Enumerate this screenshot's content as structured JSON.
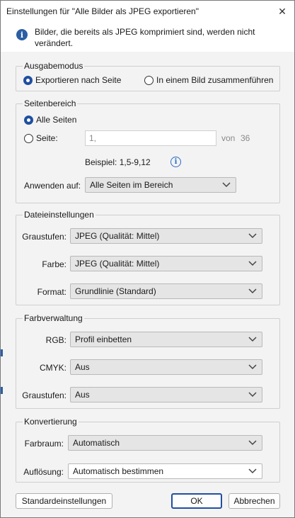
{
  "window": {
    "title": "Einstellungen für \"Alle Bilder als JPEG exportieren\""
  },
  "info": {
    "text": "Bilder, die bereits als JPEG komprimiert sind, werden nicht verändert."
  },
  "output_mode": {
    "legend": "Ausgabemodus",
    "option_per_page": "Exportieren nach Seite",
    "option_merge": "In einem Bild zusammenführen",
    "selected": "per_page"
  },
  "page_range": {
    "legend": "Seitenbereich",
    "option_all": "Alle Seiten",
    "option_page": "Seite:",
    "page_input_value": "1,",
    "of_label": "von",
    "total_pages": "36",
    "example": "Beispiel: 1,5-9,12",
    "apply_label": "Anwenden auf:",
    "apply_value": "Alle Seiten im Bereich",
    "selected": "all"
  },
  "file_settings": {
    "legend": "Dateieinstellungen",
    "grayscale_label": "Graustufen:",
    "grayscale_value": "JPEG (Qualität: Mittel)",
    "color_label": "Farbe:",
    "color_value": "JPEG (Qualität: Mittel)",
    "format_label": "Format:",
    "format_value": "Grundlinie (Standard)"
  },
  "color_management": {
    "legend": "Farbverwaltung",
    "rgb_label": "RGB:",
    "rgb_value": "Profil einbetten",
    "cmyk_label": "CMYK:",
    "cmyk_value": "Aus",
    "grayscale_label": "Graustufen:",
    "grayscale_value": "Aus"
  },
  "conversion": {
    "legend": "Konvertierung",
    "colorspace_label": "Farbraum:",
    "colorspace_value": "Automatisch",
    "resolution_label": "Auflösung:",
    "resolution_value": "Automatisch bestimmen"
  },
  "footer": {
    "defaults_label": "Standardeinstellungen",
    "ok_label": "OK",
    "cancel_label": "Abbrechen"
  },
  "colors": {
    "accent": "#1f4fa0",
    "dialog_bg": "#f3f3f3",
    "dropdown_bg": "#e5e5e5"
  }
}
